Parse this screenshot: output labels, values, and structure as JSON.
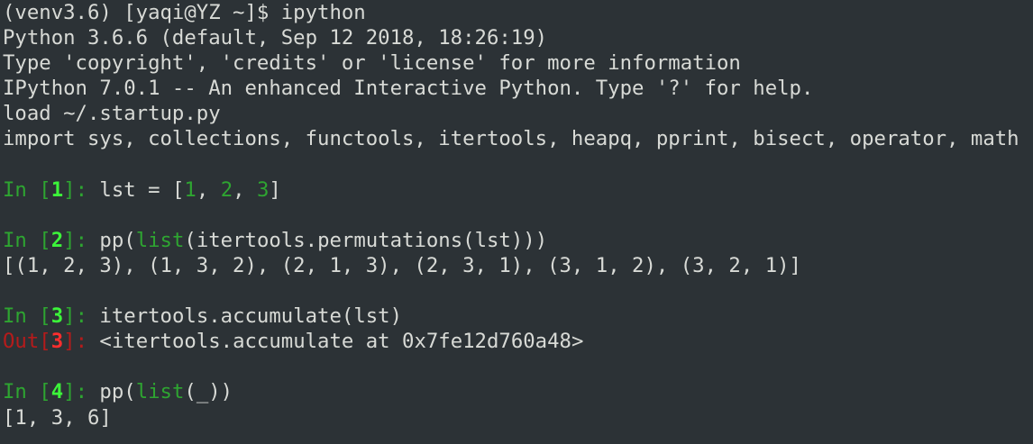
{
  "terminal": {
    "shell_prompt": "(venv3.6) [yaqi@YZ ~]$ ipython",
    "banner": [
      "Python 3.6.6 (default, Sep 12 2018, 18:26:19)",
      "Type 'copyright', 'credits' or 'license' for more information",
      "IPython 7.0.1 -- An enhanced Interactive Python. Type '?' for help.",
      "load ~/.startup.py",
      "import sys, collections, functools, itertools, heapq, pprint, bisect, operator, math"
    ],
    "cells": [
      {
        "in_label": "In [",
        "in_number": "1",
        "in_close": "]: ",
        "code_pre": "lst = [",
        "n1": "1",
        "sep1": ", ",
        "n2": "2",
        "sep2": ", ",
        "n3": "3",
        "code_post": "]"
      },
      {
        "in_label": "In [",
        "in_number": "2",
        "in_close": "]: ",
        "code_pre": "pp(",
        "builtin": "list",
        "code_post": "(itertools.permutations(lst)))",
        "output": "[(1, 2, 3), (1, 3, 2), (2, 1, 3), (2, 3, 1), (3, 1, 2), (3, 2, 1)]"
      },
      {
        "in_label": "In [",
        "in_number": "3",
        "in_close": "]: ",
        "code": "itertools.accumulate(lst)",
        "out_label": "Out[",
        "out_number": "3",
        "out_close": "]: ",
        "output": "<itertools.accumulate at 0x7fe12d760a48>"
      },
      {
        "in_label": "In [",
        "in_number": "4",
        "in_close": "]: ",
        "code_pre": "pp(",
        "builtin": "list",
        "code_post": "(_))",
        "output": "[1, 3, 6]"
      }
    ]
  },
  "colors": {
    "background": "#2c3236",
    "text": "#d8dad6",
    "prompt_green": "#2ea531",
    "prompt_number_green": "#3cf43a",
    "out_red": "#b51b1b",
    "out_number_red": "#ff2e2e"
  }
}
